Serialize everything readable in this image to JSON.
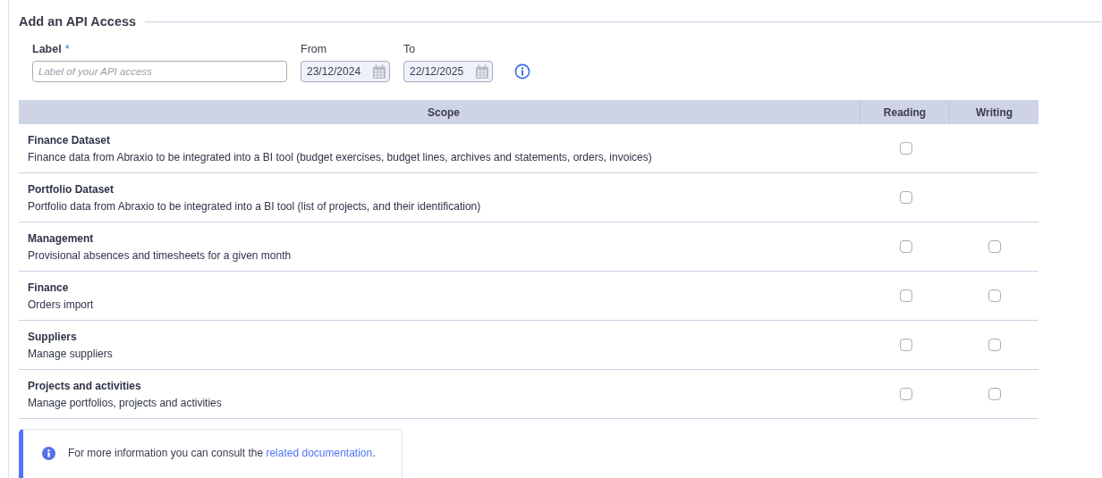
{
  "section": {
    "title": "Add an API Access"
  },
  "form": {
    "label": {
      "caption": "Label",
      "required_mark": "*",
      "placeholder": "Label of your API access"
    },
    "from": {
      "caption": "From",
      "value": "23/12/2024"
    },
    "to": {
      "caption": "To",
      "value": "22/12/2025"
    }
  },
  "table": {
    "columns": [
      "Scope",
      "Reading",
      "Writing"
    ],
    "rows": [
      {
        "name": "Finance Dataset",
        "description": "Finance data from Abraxio to be integrated into a BI tool (budget exercises, budget lines, archives and statements, orders, invoices)",
        "reading": {
          "checked": false
        }
      },
      {
        "name": "Portfolio Dataset",
        "description": "Portfolio data from Abraxio to be integrated into a BI tool (list of projects, and their identification)",
        "reading": {
          "checked": false
        }
      },
      {
        "name": "Management",
        "description": "Provisional absences and timesheets for a given month",
        "reading": {
          "checked": false
        },
        "writing": {
          "checked": false
        }
      },
      {
        "name": "Finance",
        "description": "Orders import",
        "reading": {
          "checked": false
        },
        "writing": {
          "checked": false
        }
      },
      {
        "name": "Suppliers",
        "description": "Manage suppliers",
        "reading": {
          "checked": false
        },
        "writing": {
          "checked": false
        }
      },
      {
        "name": "Projects and activities",
        "description": "Manage portfolios, projects and activities",
        "reading": {
          "checked": false
        },
        "writing": {
          "checked": false
        }
      }
    ]
  },
  "notice": {
    "text": "For more information you can consult the ",
    "link": "related documentation",
    "after": "."
  }
}
